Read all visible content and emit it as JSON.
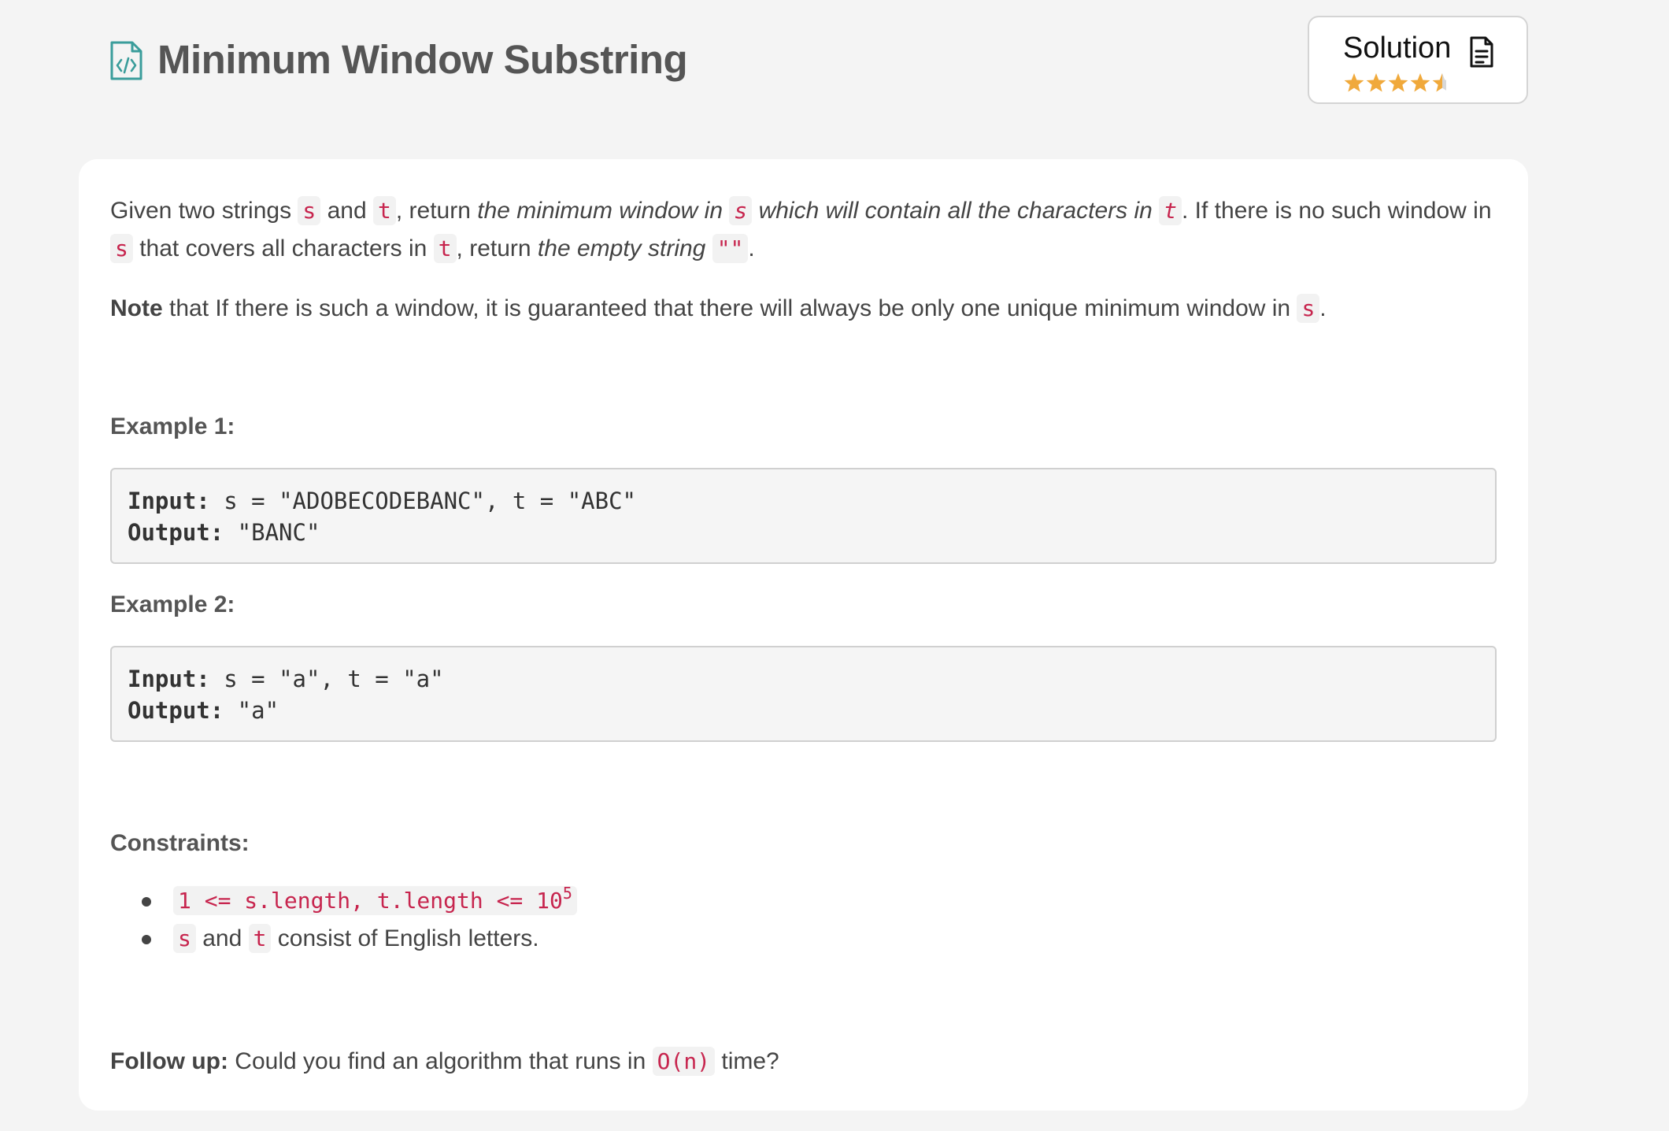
{
  "header": {
    "title": "Minimum Window Substring",
    "title_icon": "code-file-icon",
    "solution_label": "Solution",
    "solution_icon": "document-icon",
    "rating": 4.5,
    "rating_max": 5
  },
  "colors": {
    "accent_icon": "#3a9d9b",
    "star": "#f0a93b",
    "code_text": "#c7254e",
    "background": "#f4f4f4"
  },
  "description": {
    "p1_a": "Given two strings ",
    "s": "s",
    "and": " and ",
    "t": "t",
    "p1_b": ", return ",
    "p1_em1": "the minimum window in ",
    "p1_em2": " which will contain all the characters in ",
    "p1_c": ". If there is no such window in",
    "p2_a": " that covers all characters in ",
    "p2_b": ", return ",
    "p2_em": "the empty string",
    "p2_c": " ",
    "empty": "\"\"",
    "period": ".",
    "note_bold": "Note",
    "note_text": " that If there is such a window, it is guaranteed that there will always be only one unique minimum window in "
  },
  "examples": [
    {
      "heading": "Example 1:",
      "input_label": "Input:",
      "input_value": " s = \"ADOBECODEBANC\", t = \"ABC\"",
      "output_label": "Output:",
      "output_value": " \"BANC\""
    },
    {
      "heading": "Example 2:",
      "input_label": "Input:",
      "input_value": " s = \"a\", t = \"a\"",
      "output_label": "Output:",
      "output_value": " \"a\""
    }
  ],
  "constraints": {
    "heading": "Constraints:",
    "c1_code": "1 <= s.length, t.length <= 10",
    "c1_sup": "5",
    "c2_and": " and ",
    "c2_text": " consist of English letters."
  },
  "followup": {
    "bold": "Follow up:",
    "text_a": " Could you find an algorithm that runs in ",
    "code": "O(n)",
    "text_b": " time?"
  }
}
